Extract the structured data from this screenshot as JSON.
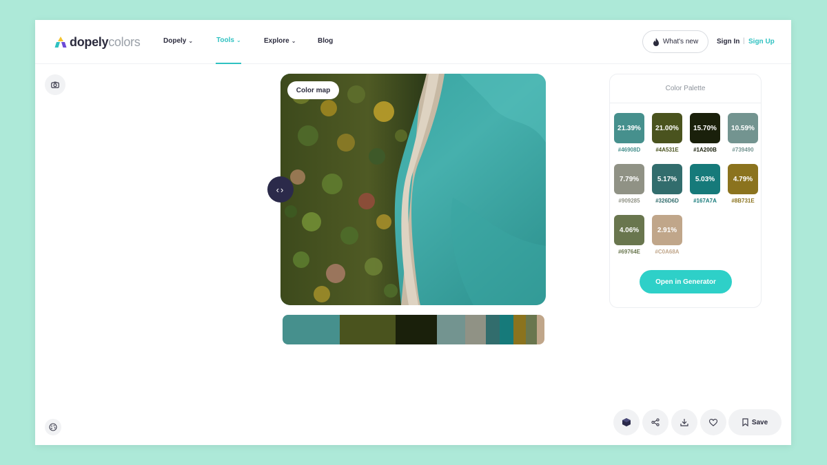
{
  "brand": {
    "name_bold": "dopely",
    "name_light": "colors"
  },
  "nav": {
    "items": [
      {
        "label": "Dopely",
        "has_dropdown": true,
        "active": false
      },
      {
        "label": "Tools",
        "has_dropdown": true,
        "active": true
      },
      {
        "label": "Explore",
        "has_dropdown": true,
        "active": false
      },
      {
        "label": "Blog",
        "has_dropdown": false,
        "active": false
      }
    ],
    "whats_new": "What's new",
    "sign_in": "Sign In",
    "separator": "|",
    "sign_up": "Sign Up"
  },
  "image": {
    "overlay_label": "Color map",
    "icon_left_top": "camera-icon",
    "icon_left_bottom": "palette-icon"
  },
  "palette": {
    "title": "Color Palette",
    "colors": [
      {
        "percent": "21.39%",
        "hex": "#46908D",
        "share": 21.39
      },
      {
        "percent": "21.00%",
        "hex": "#4A531E",
        "share": 21.0
      },
      {
        "percent": "15.70%",
        "hex": "#1A200B",
        "share": 15.7
      },
      {
        "percent": "10.59%",
        "hex": "#739490",
        "share": 10.59
      },
      {
        "percent": "7.79%",
        "hex": "#909285",
        "share": 7.79
      },
      {
        "percent": "5.17%",
        "hex": "#326D6D",
        "share": 5.17
      },
      {
        "percent": "5.03%",
        "hex": "#167A7A",
        "share": 5.03
      },
      {
        "percent": "4.79%",
        "hex": "#8B731E",
        "share": 4.79
      },
      {
        "percent": "4.06%",
        "hex": "#69764E",
        "share": 4.06
      },
      {
        "percent": "2.91%",
        "hex": "#C0A68A",
        "share": 2.91
      }
    ],
    "cta": "Open in Generator"
  },
  "actions": {
    "save": "Save",
    "icons": [
      "cube-icon",
      "share-icon",
      "download-icon",
      "heart-icon",
      "bookmark-icon"
    ]
  },
  "theme": {
    "accent": "#2fc1c1",
    "button": "#2ed0c8",
    "handle": "#2b2a4a",
    "background": "#ade9d8"
  }
}
